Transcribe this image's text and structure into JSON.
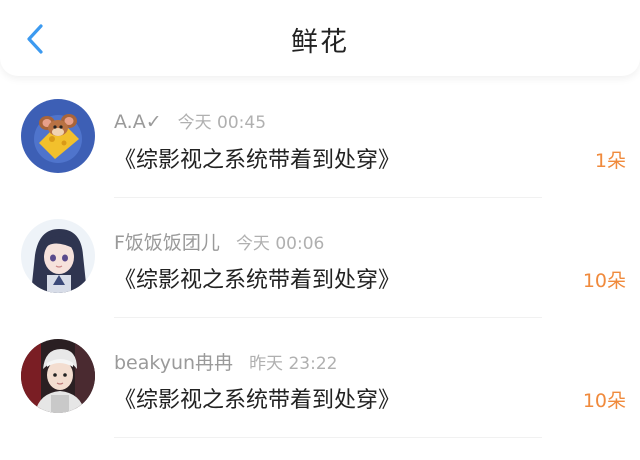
{
  "header": {
    "title": "鲜花",
    "back_icon": "chevron-left-icon",
    "accent_color": "#3c9af0"
  },
  "items": [
    {
      "name": "A.A✓",
      "time": "今天 00:45",
      "book": "《综影视之系统带着到处穿》",
      "count": "1朵",
      "avatar": "cartoon-mouse-avatar"
    },
    {
      "name": "F饭饭饭团儿",
      "time": "今天 00:06",
      "book": "《综影视之系统带着到处穿》",
      "count": "10朵",
      "avatar": "anime-girl-avatar"
    },
    {
      "name": "beakyun冉冉",
      "time": "昨天 23:22",
      "book": "《综影视之系统带着到处穿》",
      "count": "10朵",
      "avatar": "photo-person-avatar"
    }
  ],
  "count_color": "#f08a3c"
}
